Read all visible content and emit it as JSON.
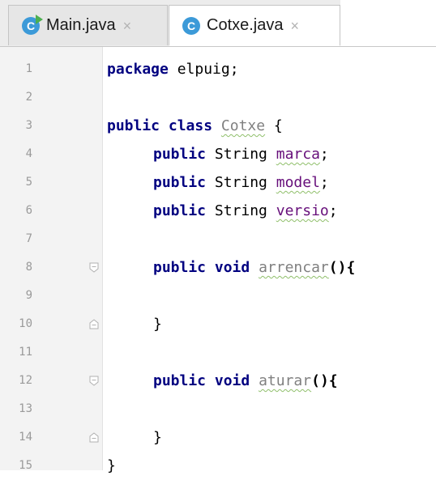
{
  "tabs": [
    {
      "label": "Main.java",
      "close": "×",
      "icon": "C",
      "icon_name": "java-class-run-icon",
      "active": false
    },
    {
      "label": "Cotxe.java",
      "close": "×",
      "icon": "C",
      "icon_name": "java-class-icon",
      "active": true
    }
  ],
  "editor": {
    "line_numbers": [
      "1",
      "2",
      "3",
      "4",
      "5",
      "6",
      "7",
      "8",
      "9",
      "10",
      "11",
      "12",
      "13",
      "14",
      "15"
    ],
    "lines": {
      "l1": {
        "kw": "package",
        "rest": " elpuig;"
      },
      "l3": {
        "kw1": "public",
        "kw2": "class",
        "name": "Cotxe",
        "rest": " {"
      },
      "l4": {
        "kw": "public",
        "type": " String ",
        "name": "marca",
        "rest": ";"
      },
      "l5": {
        "kw": "public",
        "type": " String ",
        "name": "model",
        "rest": ";"
      },
      "l6": {
        "kw": "public",
        "type": " String ",
        "name": "versio",
        "rest": ";"
      },
      "l8": {
        "kw1": "public",
        "kw2": "void",
        "name": "arrencar",
        "rest": "(){"
      },
      "l10": {
        "text": "}"
      },
      "l12": {
        "kw1": "public",
        "kw2": "void",
        "name": "aturar",
        "rest": "(){"
      },
      "l14": {
        "text": "}"
      },
      "l15": {
        "text": "}"
      }
    }
  },
  "colors": {
    "keyword": "#000080",
    "icon_bg": "#3c9ad8",
    "run_badge": "#4caf50",
    "warning_underline": "#8fbf6a",
    "line_number": "#9a9a9a"
  }
}
